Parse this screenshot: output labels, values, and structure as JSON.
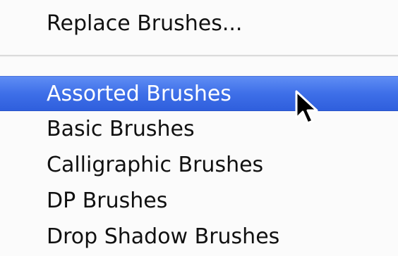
{
  "menu": {
    "items": [
      {
        "label": "Replace Brushes..."
      },
      {
        "label": "Assorted Brushes",
        "highlighted": true
      },
      {
        "label": "Basic Brushes"
      },
      {
        "label": "Calligraphic Brushes"
      },
      {
        "label": "DP Brushes"
      },
      {
        "label": "Drop Shadow Brushes"
      }
    ]
  },
  "colors": {
    "highlight": "#3e6fe8",
    "text": "#111111",
    "highlight_text": "#ffffff"
  },
  "icons": {
    "cursor": "mouse-pointer-icon"
  }
}
